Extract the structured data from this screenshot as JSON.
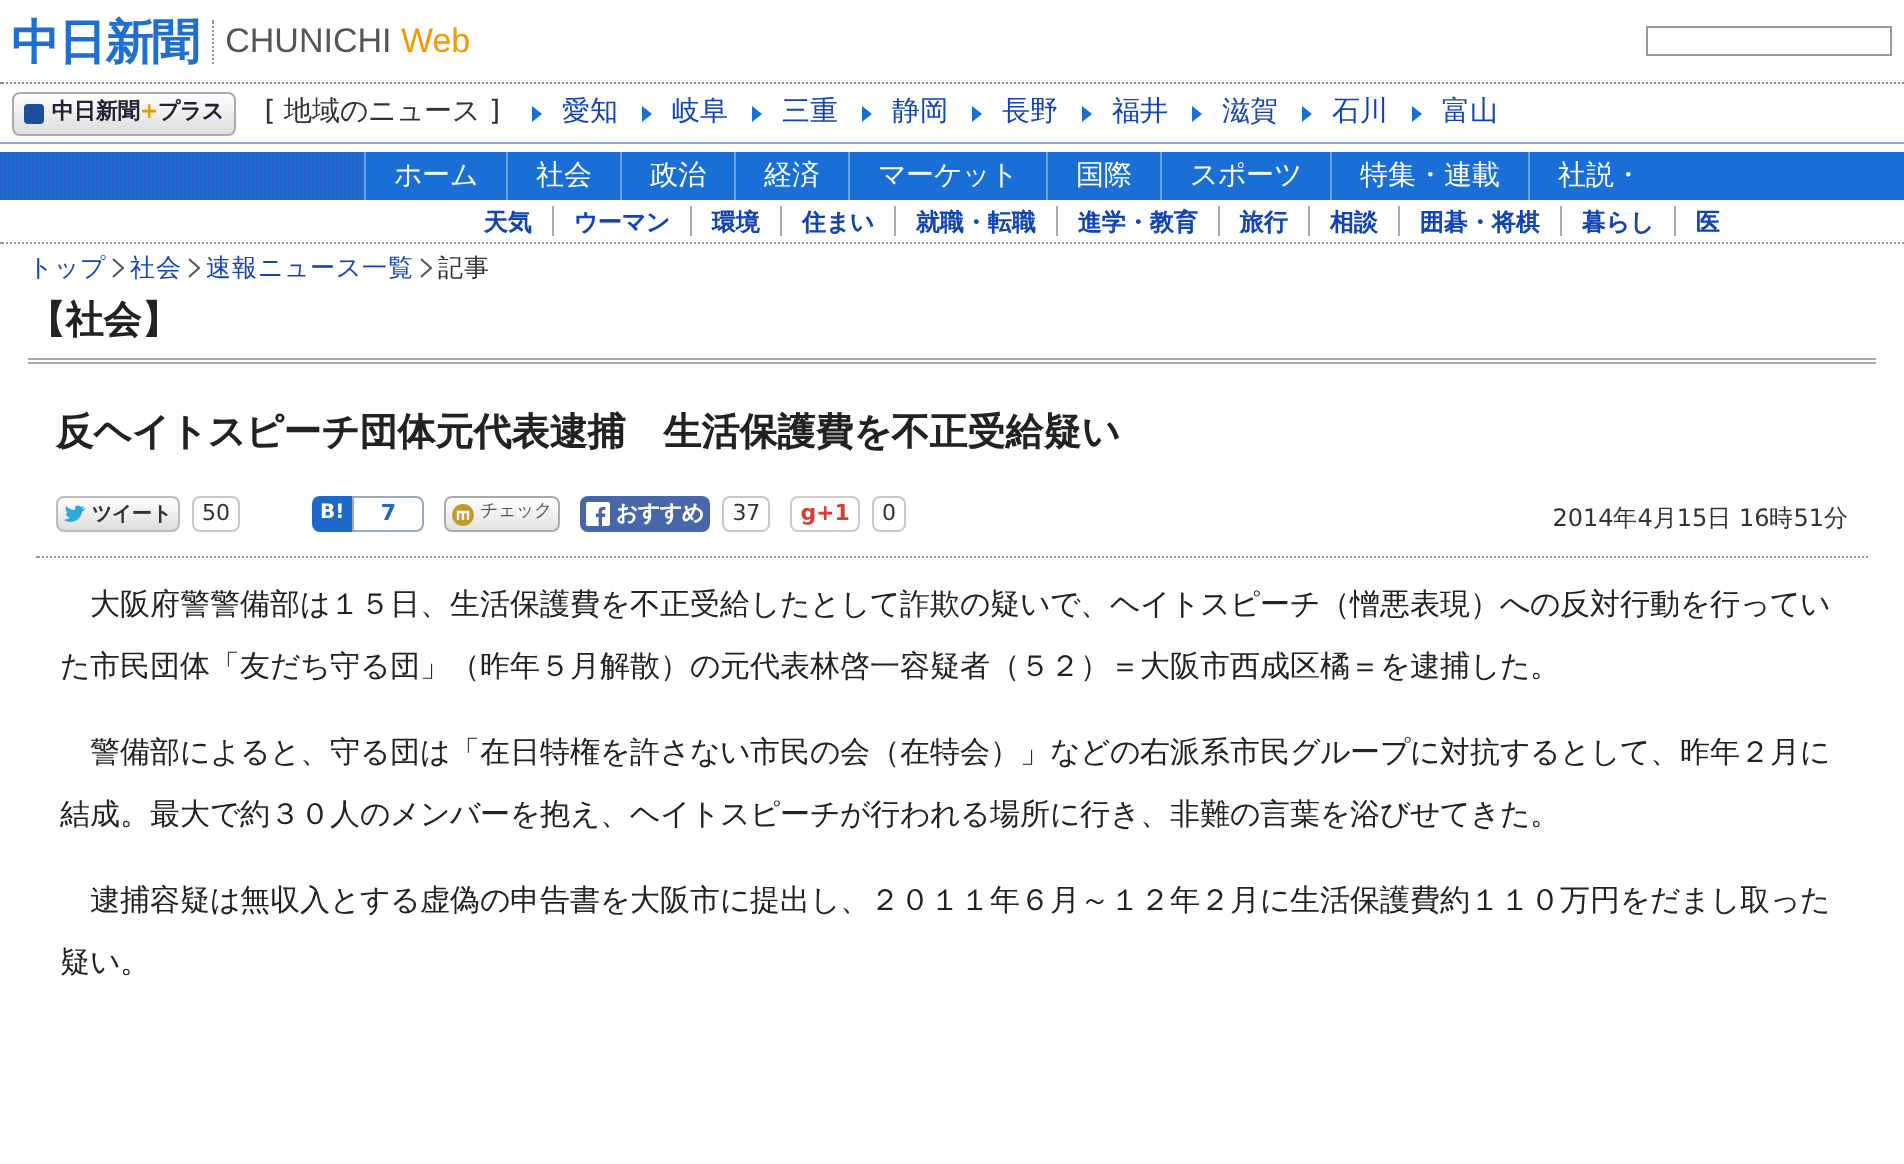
{
  "header": {
    "logo": "中日新聞",
    "brand_main": "CHUNICHI ",
    "brand_accent": "Web"
  },
  "plus_button": {
    "label": "中日新聞",
    "accent": "+",
    "label_end": "プラス"
  },
  "region_label": "[ 地域のニュース ]",
  "regions": [
    "愛知",
    "岐阜",
    "三重",
    "静岡",
    "長野",
    "福井",
    "滋賀",
    "石川",
    "富山"
  ],
  "main_nav": [
    {
      "label": "ホーム",
      "selected": false
    },
    {
      "label": "社会",
      "selected": false
    },
    {
      "label": "政治",
      "selected": false
    },
    {
      "label": "経済",
      "selected": false
    },
    {
      "label": "マーケット",
      "selected": false
    },
    {
      "label": "国際",
      "selected": false
    },
    {
      "label": "スポーツ",
      "selected": false
    },
    {
      "label": "特集・連載",
      "selected": false
    },
    {
      "label": "社説・",
      "selected": false
    }
  ],
  "sub_nav": [
    "天気",
    "ウーマン",
    "環境",
    "住まい",
    "就職・転職",
    "進学・教育",
    "旅行",
    "相談",
    "囲碁・将棋",
    "暮らし",
    "医"
  ],
  "breadcrumb": [
    "トップ",
    "社会",
    "速報ニュース一覧",
    "記事"
  ],
  "section": "【社会】",
  "headline": "反ヘイトスピーチ団体元代表逮捕　生活保護費を不正受給疑い",
  "share": [
    {
      "kind": "tweet",
      "label": "ツイート",
      "count": "50"
    },
    {
      "kind": "hatena",
      "label": "B!",
      "count": "7"
    },
    {
      "kind": "check",
      "label": "チェック"
    },
    {
      "kind": "facebook",
      "label": "おすすめ",
      "count": "37"
    },
    {
      "kind": "gplus",
      "label": "g+1",
      "count": "0"
    }
  ],
  "date": "2014年4月15日 16時51分",
  "paragraphs": [
    "大阪府警警備部は１５日、生活保護費を不正受給したとして詐欺の疑いで、ヘイトスピーチ（憎悪表現）への反対行動を行っていた市民団体「友だち守る団」（昨年５月解散）の元代表林啓一容疑者（５２）＝大阪市西成区橘＝を逮捕した。",
    "警備部によると、守る団は「在日特権を許さない市民の会（在特会）」などの右派系市民グループに対抗するとして、昨年２月に結成。最大で約３０人のメンバーを抱え、ヘイトスピーチが行われる場所に行き、非難の言葉を浴びせてきた。",
    "逮捕容疑は無収入とする虚偽の申告書を大阪市に提出し、２０１１年６月～１２年２月に生活保護費約１１０万円をだまし取った疑い。"
  ]
}
